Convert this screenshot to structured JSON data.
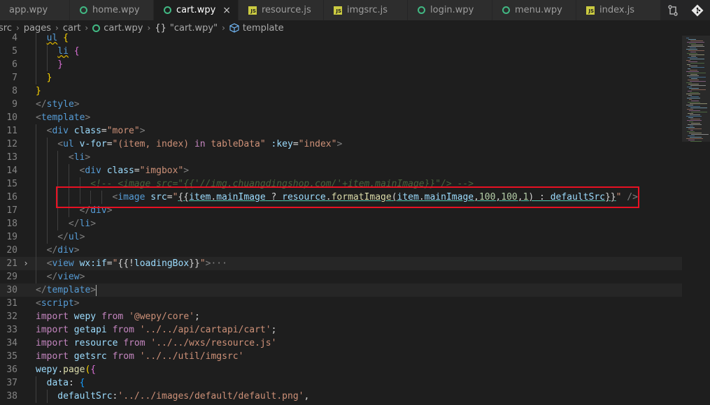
{
  "tabs": [
    {
      "label": "app.wpy",
      "icon": "vue-file-icon",
      "active": false
    },
    {
      "label": "home.wpy",
      "icon": "vue-file-icon",
      "active": false
    },
    {
      "label": "cart.wpy",
      "icon": "vue-file-icon",
      "active": true
    },
    {
      "label": "resource.js",
      "icon": "js-file-icon",
      "active": false
    },
    {
      "label": "imgsrc.js",
      "icon": "js-file-icon",
      "active": false
    },
    {
      "label": "login.wpy",
      "icon": "vue-file-icon",
      "active": false
    },
    {
      "label": "menu.wpy",
      "icon": "vue-file-icon",
      "active": false
    },
    {
      "label": "index.js",
      "icon": "js-file-icon",
      "active": false
    }
  ],
  "tab_close_glyph": "×",
  "js_badge": "JS",
  "tab_actions": [
    "compare-changes-icon",
    "git-icon"
  ],
  "breadcrumb": {
    "segments": [
      "src",
      "pages",
      "cart",
      "cart.wpy",
      "{}",
      "\"cart.wpy\"",
      "template"
    ],
    "separator": "›"
  },
  "colors": {
    "background": "#1e1e1e",
    "tag": "#569cd6",
    "attribute": "#9cdcfe",
    "string": "#ce9178",
    "keyword": "#c586c0",
    "function": "#dcdcaa",
    "highlight_box": "#e81123"
  },
  "editor": {
    "fold_collapsed_glyph": "›",
    "lines": [
      {
        "n": "4",
        "code": "ul {"
      },
      {
        "n": "5",
        "code": "li {"
      },
      {
        "n": "6",
        "code": "}"
      },
      {
        "n": "7",
        "code": "}"
      },
      {
        "n": "8",
        "code": "}"
      },
      {
        "n": "9",
        "code": "</style>"
      },
      {
        "n": "10",
        "code": "<template>"
      },
      {
        "n": "11",
        "code": "<div class=\"more\">"
      },
      {
        "n": "12",
        "code": "<ul v-for=\"(item, index) in tableData\" :key=\"index\">"
      },
      {
        "n": "13",
        "code": "<li>"
      },
      {
        "n": "14",
        "code": "<div class=\"imgbox\">"
      },
      {
        "n": "15",
        "code": "<!-- <image src=\"{{'//img.chuangdingshop.com/'+item.mainImage}}\"/> -->"
      },
      {
        "n": "16",
        "code": "<image src=\"{{item.mainImage ? resource.formatImage(item.mainImage,100,100,1) : defaultSrc}}\" />"
      },
      {
        "n": "17",
        "code": "</div>"
      },
      {
        "n": "18",
        "code": "</li>"
      },
      {
        "n": "19",
        "code": "</ul>"
      },
      {
        "n": "20",
        "code": "</div>"
      },
      {
        "n": "21",
        "code": "<view wx:if=\"{{!loadingBox}}\">···"
      },
      {
        "n": "29",
        "code": "</view>"
      },
      {
        "n": "30",
        "code": "</template>"
      },
      {
        "n": "31",
        "code": "<script>"
      },
      {
        "n": "32",
        "code": "import wepy from '@wepy/core';"
      },
      {
        "n": "33",
        "code": "import getapi from '../../api/cartapi/cart';"
      },
      {
        "n": "34",
        "code": "import resource from '../../wxs/resource.js'"
      },
      {
        "n": "35",
        "code": "import getsrc from '../../util/imgsrc'"
      },
      {
        "n": "36",
        "code": "wepy.page({"
      },
      {
        "n": "37",
        "code": "data: {"
      },
      {
        "n": "38",
        "code": "defaultSrc:'../../images/default/default.png',"
      }
    ]
  }
}
